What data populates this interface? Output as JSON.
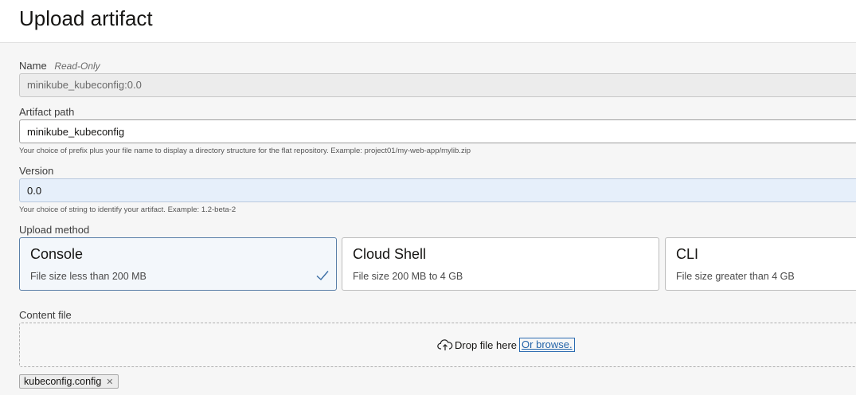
{
  "header": {
    "title": "Upload artifact"
  },
  "name": {
    "label": "Name",
    "readonly_tag": "Read-Only",
    "value": "minikube_kubeconfig:0.0"
  },
  "artifact_path": {
    "label": "Artifact path",
    "value": "minikube_kubeconfig",
    "hint": "Your choice of prefix plus your file name to display a directory structure for the flat repository. Example: project01/my-web-app/mylib.zip"
  },
  "version": {
    "label": "Version",
    "value": "0.0",
    "hint": "Your choice of string to identify your artifact. Example: 1.2-beta-2"
  },
  "upload_method": {
    "label": "Upload method",
    "options": [
      {
        "title": "Console",
        "desc": "File size less than 200 MB",
        "selected": true
      },
      {
        "title": "Cloud Shell",
        "desc": "File size 200 MB to 4 GB",
        "selected": false
      },
      {
        "title": "CLI",
        "desc": "File size greater than 4 GB",
        "selected": false
      }
    ]
  },
  "content_file": {
    "label": "Content file",
    "drop_text": "Drop file here",
    "browse_text": "Or browse.",
    "file_chip": "kubeconfig.config",
    "remove_glyph": "✕"
  },
  "colors": {
    "accent": "#5a7fa8",
    "link": "#2363a8",
    "check": "#3b6ea5"
  }
}
